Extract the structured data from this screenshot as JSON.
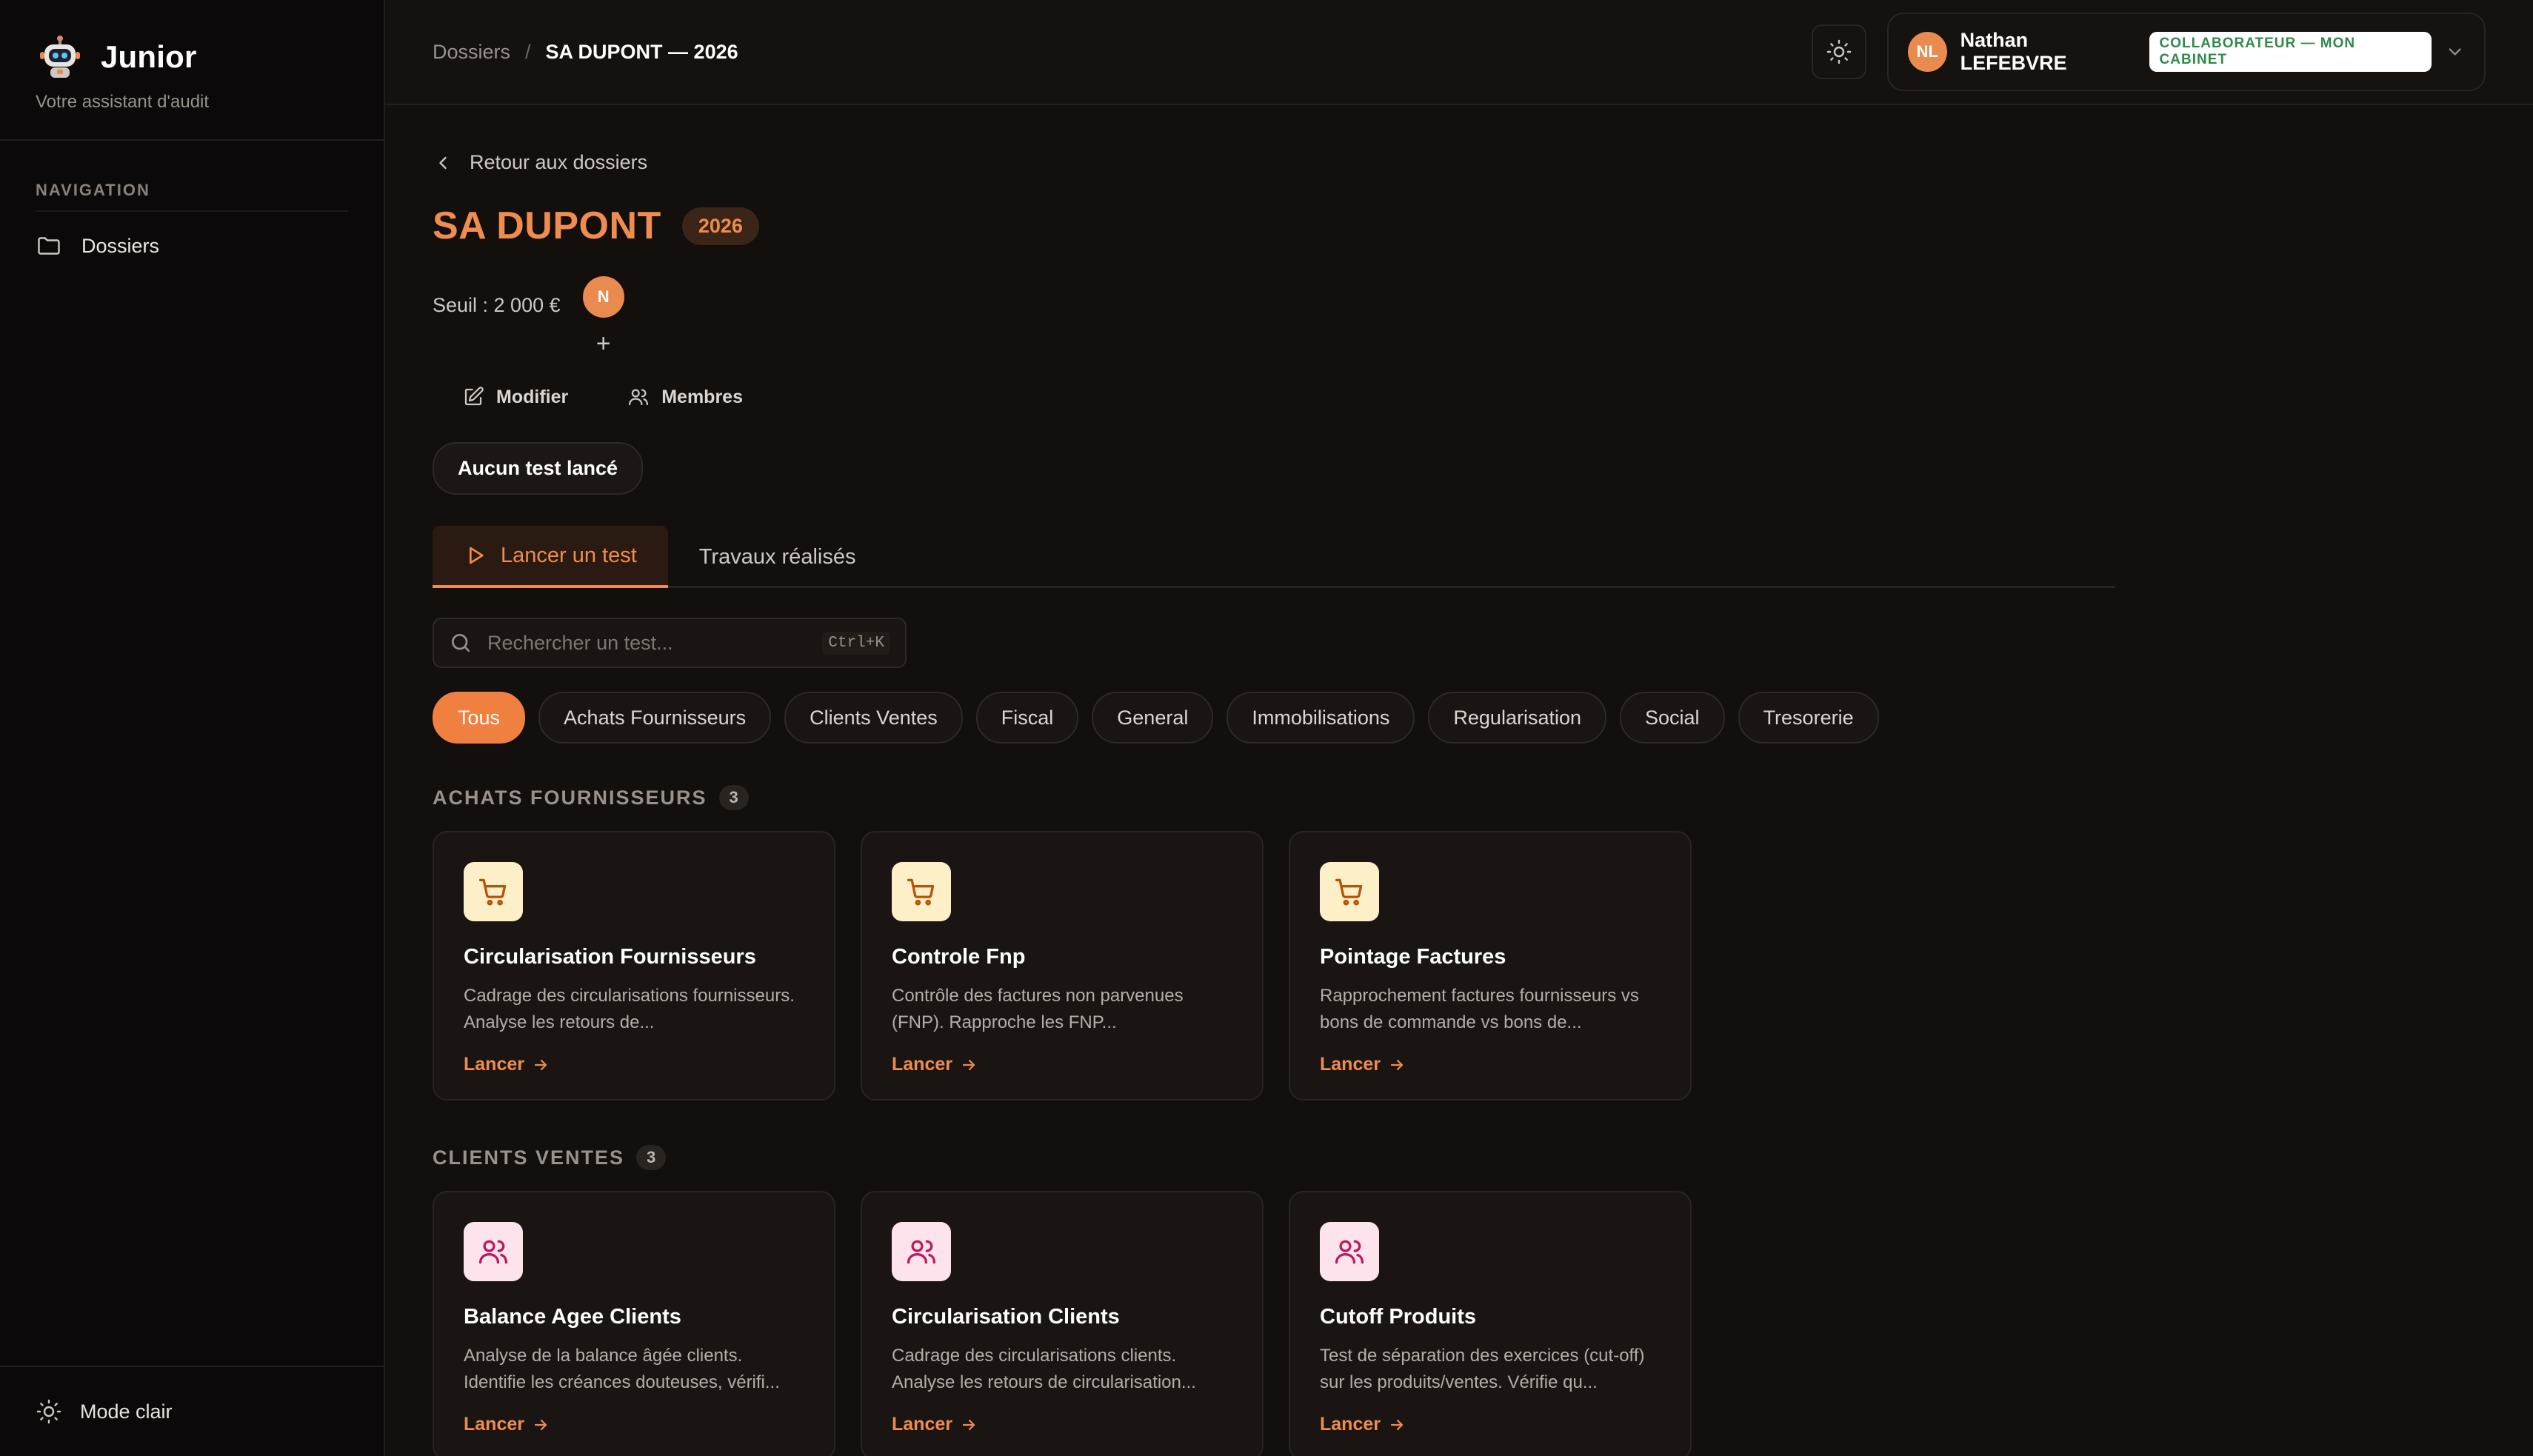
{
  "brand": {
    "name": "Junior",
    "subtitle": "Votre assistant d'audit"
  },
  "nav": {
    "label": "NAVIGATION",
    "items": [
      {
        "label": "Dossiers",
        "icon": "folder-icon"
      }
    ]
  },
  "sidebar_footer": {
    "label": "Mode clair",
    "icon": "sun-icon"
  },
  "breadcrumb": {
    "parent": "Dossiers",
    "separator": "/",
    "current": "SA DUPONT — 2026"
  },
  "user": {
    "initials": "NL",
    "name": "Nathan LEFEBVRE",
    "role": "COLLABORATEUR — MON CABINET"
  },
  "dossier": {
    "back_label": "Retour aux dossiers",
    "title": "SA DUPONT",
    "year": "2026",
    "seuil": "Seuil : 2 000 €",
    "member_initial": "N",
    "add_member": "+",
    "actions": {
      "edit": "Modifier",
      "members": "Membres"
    },
    "status": "Aucun test lancé"
  },
  "tabs": [
    {
      "label": "Lancer un test",
      "active": true
    },
    {
      "label": "Travaux réalisés",
      "active": false
    }
  ],
  "search": {
    "placeholder": "Rechercher un test...",
    "shortcut": "Ctrl+K"
  },
  "filters": [
    "Tous",
    "Achats Fournisseurs",
    "Clients Ventes",
    "Fiscal",
    "General",
    "Immobilisations",
    "Regularisation",
    "Social",
    "Tresorerie"
  ],
  "sections": [
    {
      "title": "ACHATS FOURNISSEURS",
      "count": "3",
      "icon": "shopping-cart-icon",
      "accent": "#fdf0c8",
      "cards": [
        {
          "title": "Circularisation Fournisseurs",
          "desc": "Cadrage des circularisations fournisseurs. Analyse les retours de...",
          "cta": "Lancer"
        },
        {
          "title": "Controle Fnp",
          "desc": "Contrôle des factures non parvenues (FNP). Rapproche les FNP...",
          "cta": "Lancer"
        },
        {
          "title": "Pointage Factures",
          "desc": "Rapprochement factures fournisseurs vs bons de commande vs bons de...",
          "cta": "Lancer"
        }
      ]
    },
    {
      "title": "CLIENTS VENTES",
      "count": "3",
      "icon": "users-icon",
      "accent": "#fde4ec",
      "cards": [
        {
          "title": "Balance Agee Clients",
          "desc": "Analyse de la balance âgée clients. Identifie les créances douteuses, vérifi...",
          "cta": "Lancer"
        },
        {
          "title": "Circularisation Clients",
          "desc": "Cadrage des circularisations clients. Analyse les retours de circularisation...",
          "cta": "Lancer"
        },
        {
          "title": "Cutoff Produits",
          "desc": "Test de séparation des exercices (cut-off) sur les produits/ventes. Vérifie qu...",
          "cta": "Lancer"
        }
      ]
    }
  ],
  "colors": {
    "accent": "#ef8c4f",
    "background": "#130f0d",
    "sidebar": "#0b0909"
  }
}
